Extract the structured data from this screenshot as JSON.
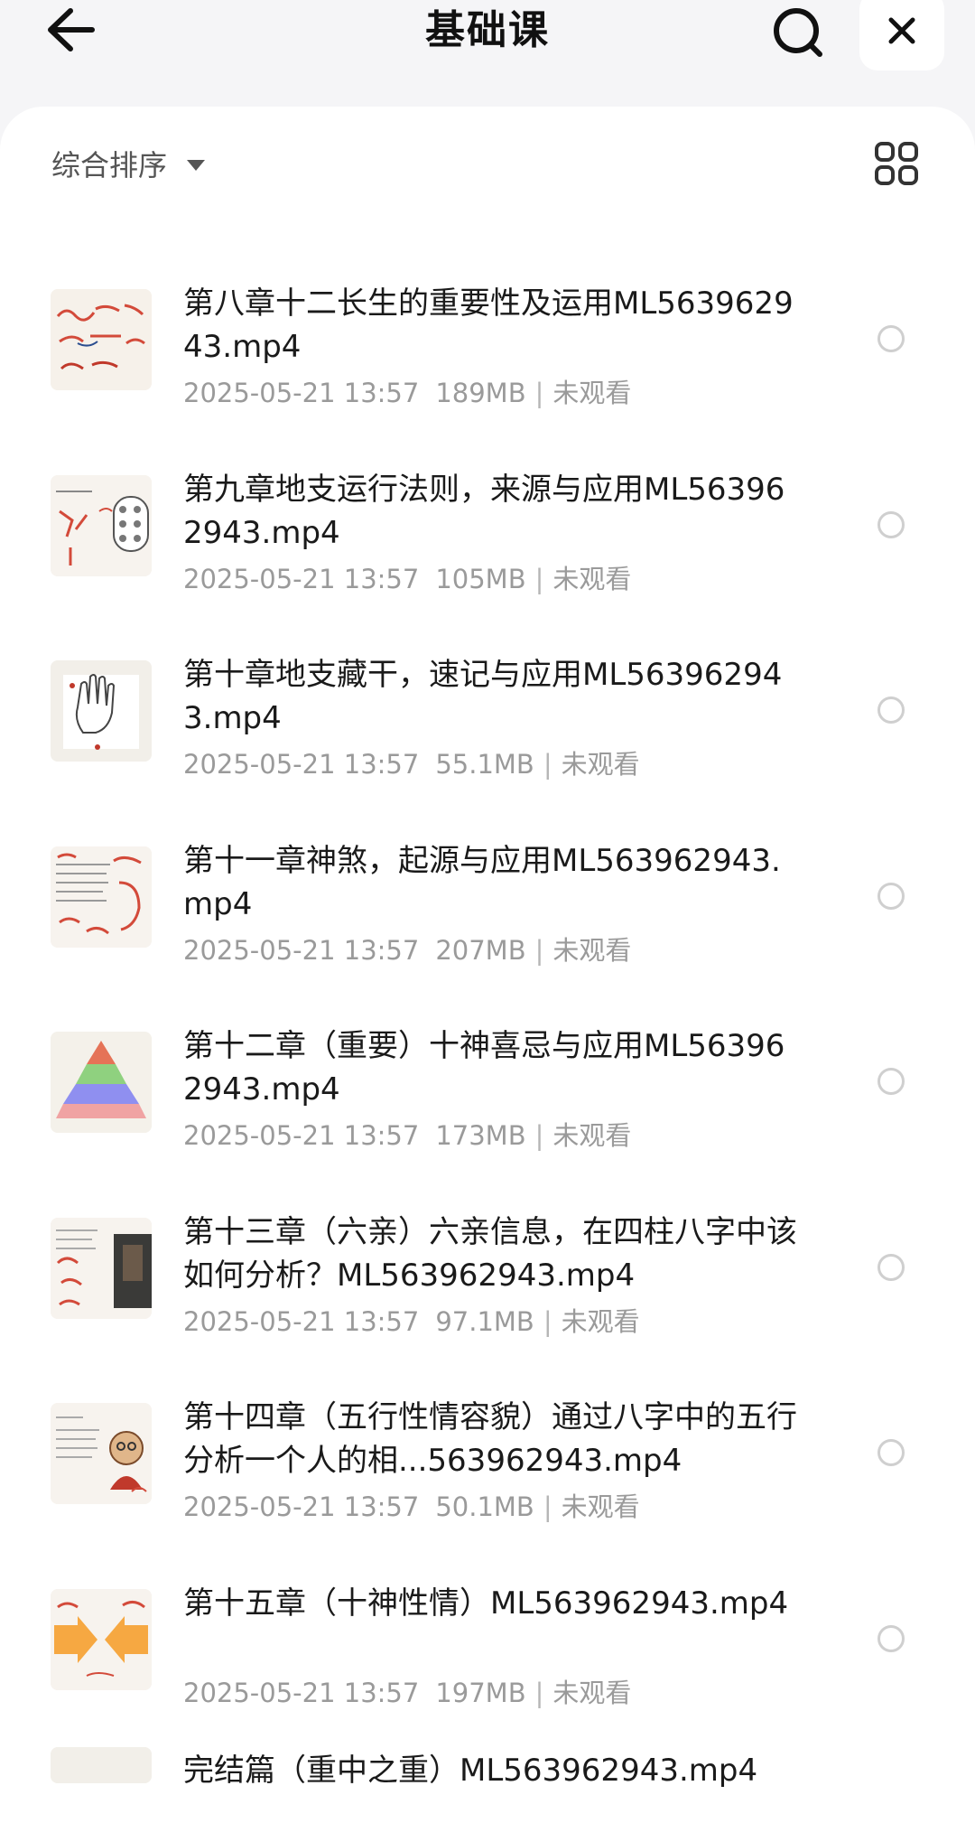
{
  "header": {
    "title": "基础课",
    "icons": {
      "back": "arrow-left-icon",
      "search": "search-icon",
      "close": "close-icon"
    }
  },
  "sort": {
    "label": "综合排序",
    "view_toggle_icon": "grid-view-icon"
  },
  "files": [
    {
      "title": "第八章十二长生的重要性及运用ML563962943.mp4",
      "date": "2025-05-21 13:57",
      "size": "189MB",
      "status": "未观看",
      "thumb": "handwriting-red-notes"
    },
    {
      "title": "第九章地支运行法则，来源与应用ML563962943.mp4",
      "date": "2025-05-21 13:57",
      "size": "105MB",
      "status": "未观看",
      "thumb": "palm-diagram-notes"
    },
    {
      "title": "第十章地支藏干，速记与应用ML563962943.mp4",
      "date": "2025-05-21 13:57",
      "size": "55.1MB",
      "status": "未观看",
      "thumb": "hand-outline"
    },
    {
      "title": "第十一章神煞，起源与应用ML563962943.mp4",
      "date": "2025-05-21 13:57",
      "size": "207MB",
      "status": "未观看",
      "thumb": "text-with-red-notes"
    },
    {
      "title": "第十二章（重要）十神喜忌与应用ML563962943.mp4",
      "date": "2025-05-21 13:57",
      "size": "173MB",
      "status": "未观看",
      "thumb": "pyramid-chart"
    },
    {
      "title": "第十三章（六亲）六亲信息，在四柱八字中该如何分析？ML563962943.mp4",
      "date": "2025-05-21 13:57",
      "size": "97.1MB",
      "status": "未观看",
      "thumb": "notes-with-photo"
    },
    {
      "title": "第十四章（五行性情容貌）通过八字中的五行分析一个人的相...563962943.mp4",
      "date": "2025-05-21 13:57",
      "size": "50.1MB",
      "status": "未观看",
      "thumb": "cartoon-figure"
    },
    {
      "title": "第十五章（十神性情）ML563962943.mp4",
      "date": "2025-05-21 13:57",
      "size": "197MB",
      "status": "未观看",
      "thumb": "orange-arrows"
    }
  ],
  "partial_item": {
    "title": "完结篇（重中之重）ML563962943.mp4"
  },
  "colors": {
    "background": "#f5f5f7",
    "panel": "#ffffff",
    "meta_text": "#9a9a9a",
    "radio_border": "#cfcfcf"
  }
}
